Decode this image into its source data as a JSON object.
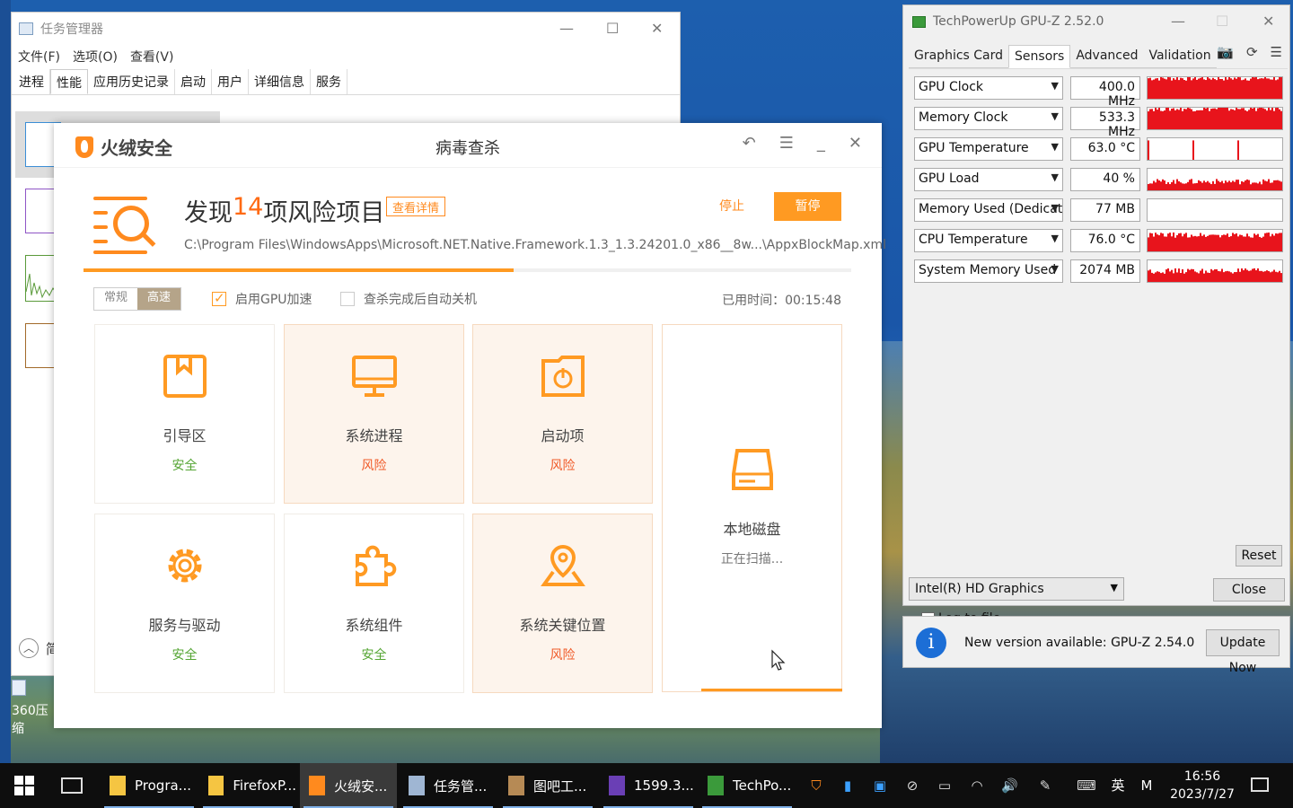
{
  "task_manager": {
    "title": "任务管理器",
    "menu": [
      "文件(F)",
      "选项(O)",
      "查看(V)"
    ],
    "tabs": [
      "进程",
      "性能",
      "应用历史记录",
      "启动",
      "用户",
      "详细信息",
      "服务"
    ],
    "active_tab": "性能",
    "fewer_details": "简"
  },
  "desktop_icon": {
    "label": "360压缩"
  },
  "huorong": {
    "brand": "火绒安全",
    "title": "病毒查杀",
    "found_prefix": "发现",
    "found_count": "14",
    "found_suffix": "项风险项目",
    "details_button": "查看详情",
    "stop_button": "停止",
    "pause_button": "暂停",
    "current_path": "C:\\Program Files\\WindowsApps\\Microsoft.NET.Native.Framework.1.3_1.3.24201.0_x86__8w...\\AppxBlockMap.xml",
    "progress": 0.56,
    "mode_normal": "常规",
    "mode_fast": "高速",
    "gpu_accel_label": "启用GPU加速",
    "gpu_accel_checked": true,
    "auto_shutdown_label": "查杀完成后自动关机",
    "auto_shutdown_checked": false,
    "elapsed": "已用时间：00:15:48",
    "tiles": [
      {
        "name": "引导区",
        "status": "安全",
        "icon": "boot-sector-icon"
      },
      {
        "name": "系统进程",
        "status": "风险",
        "icon": "monitor-icon"
      },
      {
        "name": "启动项",
        "status": "风险",
        "icon": "power-folder-icon"
      },
      {
        "name": "本地磁盘",
        "status": "正在扫描...",
        "icon": "disk-icon"
      },
      {
        "name": "服务与驱动",
        "status": "安全",
        "icon": "gear-icon"
      },
      {
        "name": "系统组件",
        "status": "安全",
        "icon": "puzzle-icon"
      },
      {
        "name": "系统关键位置",
        "status": "风险",
        "icon": "location-pin-icon"
      }
    ],
    "accent": "#ff9a22",
    "safe_color": "#54a533",
    "risk_color": "#f05a28"
  },
  "gpuz": {
    "title": "TechPowerUp GPU-Z 2.52.0",
    "tabs": [
      "Graphics Card",
      "Sensors",
      "Advanced",
      "Validation"
    ],
    "active_tab": "Sensors",
    "sensors": [
      {
        "name": "GPU Clock",
        "value": "400.0 MHz",
        "level": 0.95
      },
      {
        "name": "Memory Clock",
        "value": "533.3 MHz",
        "level": 0.95
      },
      {
        "name": "GPU Temperature",
        "value": "63.0 °C",
        "level": 0.15
      },
      {
        "name": "GPU Load",
        "value": "40 %",
        "level": 0.4
      },
      {
        "name": "Memory Used (Dedicated)",
        "value": "77 MB",
        "level": 0
      },
      {
        "name": "CPU Temperature",
        "value": "76.0 °C",
        "level": 0.75
      },
      {
        "name": "System Memory Used",
        "value": "2074 MB",
        "level": 0.5
      }
    ],
    "log_to_file": "Log to file",
    "reset_button": "Reset",
    "close_button": "Close",
    "gpu_select": "Intel(R) HD Graphics",
    "update_message": "New version available: GPU-Z 2.54.0",
    "update_button": "Update Now",
    "graph_color": "#e8141c"
  },
  "taskbar": {
    "apps": [
      {
        "label": "Progra...",
        "icon": "folder-icon",
        "active": false
      },
      {
        "label": "FirefoxP...",
        "icon": "folder-icon",
        "active": false
      },
      {
        "label": "火绒安...",
        "icon": "huorong-icon",
        "active": true
      },
      {
        "label": "任务管...",
        "icon": "task-manager-icon",
        "active": false
      },
      {
        "label": "图吧工...",
        "icon": "toolbox-icon",
        "active": false
      },
      {
        "label": "1599.3...",
        "icon": "cpu-icon",
        "active": false
      },
      {
        "label": "TechPo...",
        "icon": "gpu-z-icon",
        "active": false
      }
    ],
    "ime_lang": "英",
    "ime_mode": "M",
    "time": "16:56",
    "date": "2023/7/27"
  }
}
